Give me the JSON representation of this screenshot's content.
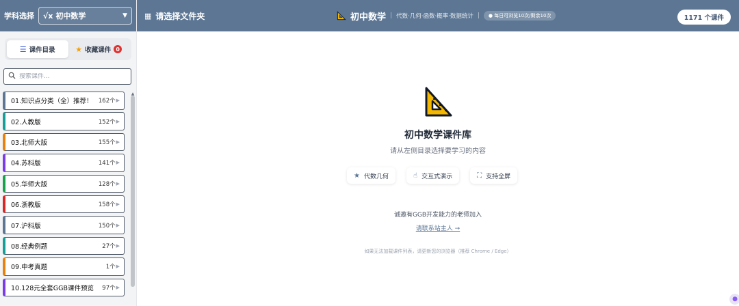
{
  "sidebar": {
    "subject_label": "学科选择",
    "subject_value": "初中数学",
    "subject_symbol": "√x",
    "tabs": [
      {
        "label": "课件目录",
        "icon": "list-icon",
        "active": true
      },
      {
        "label": "收藏课件",
        "icon": "star-icon",
        "badge": "0",
        "active": false
      }
    ],
    "search_placeholder": "搜索课件...",
    "items": [
      {
        "name": "01.知识点分类（全）推荐！",
        "count": "162个",
        "color": "#5c7694"
      },
      {
        "name": "02.人教版",
        "count": "152个",
        "color": "#14a098"
      },
      {
        "name": "03.北师大版",
        "count": "155个",
        "color": "#e8820c"
      },
      {
        "name": "04.苏科版",
        "count": "141个",
        "color": "#7c3aed"
      },
      {
        "name": "05.华师大版",
        "count": "128个",
        "color": "#16a34a"
      },
      {
        "name": "06.浙教版",
        "count": "158个",
        "color": "#dc2626"
      },
      {
        "name": "07.沪科版",
        "count": "150个",
        "color": "#5c7694"
      },
      {
        "name": "08.经典例题",
        "count": "27个",
        "color": "#14a098"
      },
      {
        "name": "09.中考真题",
        "count": "1个",
        "color": "#e8820c"
      },
      {
        "name": "10.128元全套GGB课件预览",
        "count": "97个",
        "color": "#7c3aed"
      }
    ]
  },
  "topbar": {
    "folder_label": "请选择文件夹",
    "title": "初中数学",
    "subtitle": "代数·几何·函数·概率·数据统计",
    "visit_note": "每日可浏览10次/剩余10次",
    "course_count": "1171 个课件"
  },
  "main": {
    "title": "初中数学课件库",
    "subtitle": "请从左侧目录选择要学习的内容",
    "features": [
      {
        "label": "代数几何",
        "icon": "star-icon"
      },
      {
        "label": "交互式演示",
        "icon": "pointer-hand-icon"
      },
      {
        "label": "支持全屏",
        "icon": "fullscreen-icon"
      }
    ],
    "invite": "诚邀有GGB开发能力的老师加入",
    "contact": "请联系站主人 →",
    "note": "如果无法加载课件列表，请更新您的浏览器（推荐 Chrome / Edge）"
  },
  "colors": {
    "header": "#5c7694",
    "accent_orange": "#f5b800",
    "badge_red": "#e03131"
  }
}
